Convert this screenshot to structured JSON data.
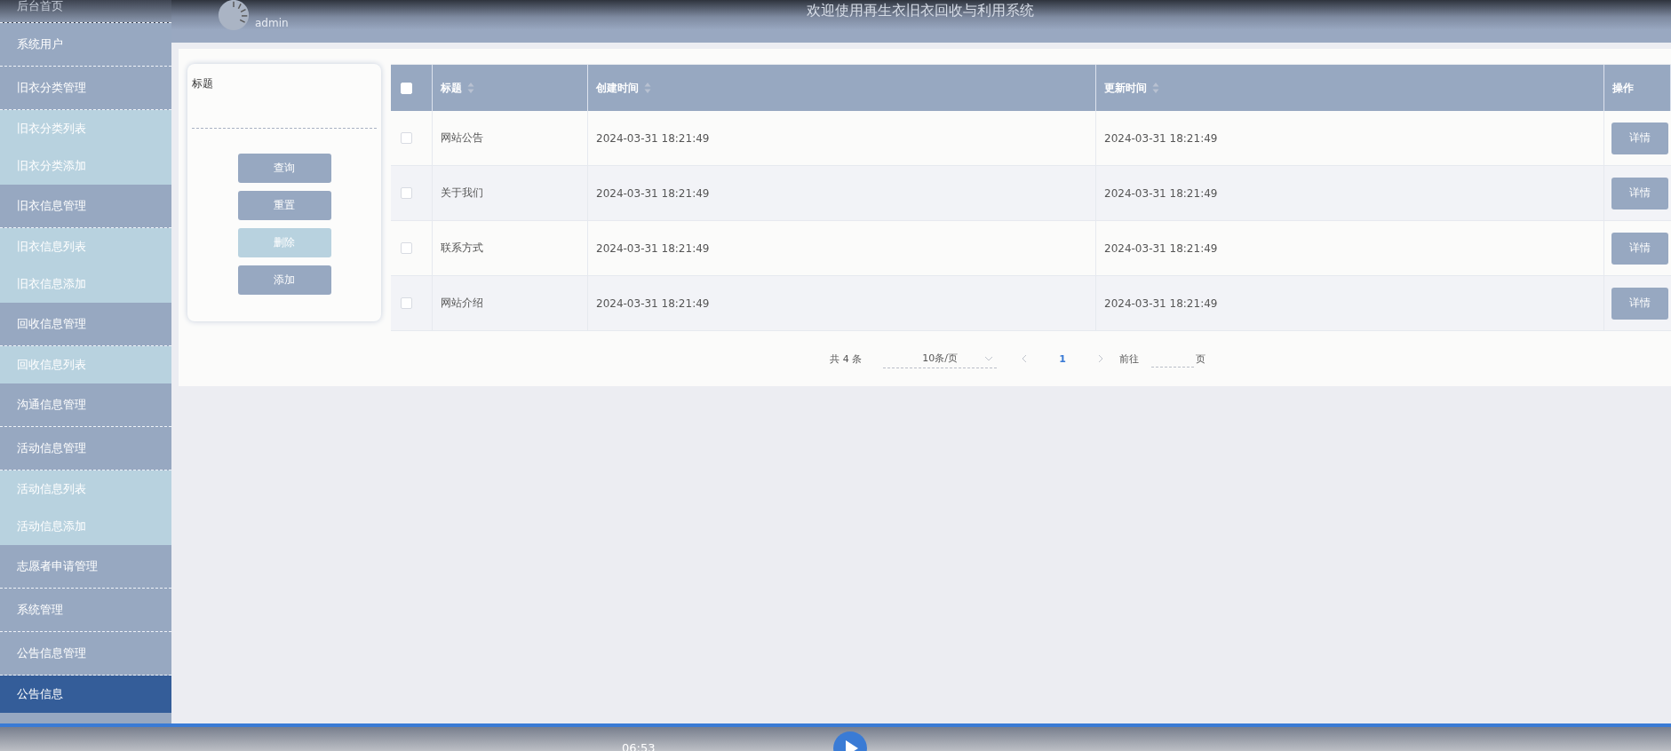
{
  "header": {
    "user": "admin",
    "title": "欢迎使用再生衣旧衣回收与利用系统"
  },
  "sidebar": {
    "items": [
      {
        "label": "后台首页",
        "selected": false
      },
      {
        "label": "系统用户",
        "selected": false
      },
      {
        "label": "旧衣分类管理",
        "selected": false,
        "expanded": true,
        "children": [
          {
            "label": "旧衣分类列表",
            "selected": false
          },
          {
            "label": "旧衣分类添加",
            "selected": false
          }
        ]
      },
      {
        "label": "旧衣信息管理",
        "selected": false,
        "expanded": true,
        "children": [
          {
            "label": "旧衣信息列表",
            "selected": false
          },
          {
            "label": "旧衣信息添加",
            "selected": false
          }
        ]
      },
      {
        "label": "回收信息管理",
        "selected": false,
        "expanded": true,
        "children": [
          {
            "label": "回收信息列表",
            "selected": false
          }
        ]
      },
      {
        "label": "沟通信息管理",
        "selected": false
      },
      {
        "label": "活动信息管理",
        "selected": false,
        "expanded": true,
        "children": [
          {
            "label": "活动信息列表",
            "selected": false
          },
          {
            "label": "活动信息添加",
            "selected": false
          }
        ]
      },
      {
        "label": "志愿者申请管理",
        "selected": false
      },
      {
        "label": "系统管理",
        "selected": false
      },
      {
        "label": "公告信息管理",
        "selected": false,
        "expanded": true,
        "children": [
          {
            "label": "公告信息",
            "selected": true
          }
        ]
      }
    ]
  },
  "search": {
    "label": "标题",
    "buttons": [
      {
        "label": "查询",
        "disabled": false
      },
      {
        "label": "重置",
        "disabled": false
      },
      {
        "label": "删除",
        "disabled": true
      },
      {
        "label": "添加",
        "disabled": false
      }
    ]
  },
  "table": {
    "all_checked": false,
    "columns": [
      {
        "label": "标题",
        "sortable": true
      },
      {
        "label": "创建时间",
        "sortable": true
      },
      {
        "label": "更新时间",
        "sortable": true
      },
      {
        "label": "操作",
        "sortable": false
      }
    ],
    "rows": [
      {
        "checked": false,
        "cells": [
          "网站公告",
          "2024-03-31 18:21:49",
          "2024-03-31 18:21:49"
        ],
        "action": "详情"
      },
      {
        "checked": false,
        "cells": [
          "关于我们",
          "2024-03-31 18:21:49",
          "2024-03-31 18:21:49"
        ],
        "action": "详情"
      },
      {
        "checked": false,
        "cells": [
          "联系方式",
          "2024-03-31 18:21:49",
          "2024-03-31 18:21:49"
        ],
        "action": "详情"
      },
      {
        "checked": false,
        "cells": [
          "网站介绍",
          "2024-03-31 18:21:49",
          "2024-03-31 18:21:49"
        ],
        "action": "详情"
      }
    ]
  },
  "pagination": {
    "total": "共 4 条",
    "page_size": "10条/页",
    "pages": [
      {
        "label": "1",
        "selected": true
      }
    ],
    "goto_label": "前往",
    "goto_suffix": "页"
  },
  "player": {
    "time": "06:53",
    "level": 1
  }
}
